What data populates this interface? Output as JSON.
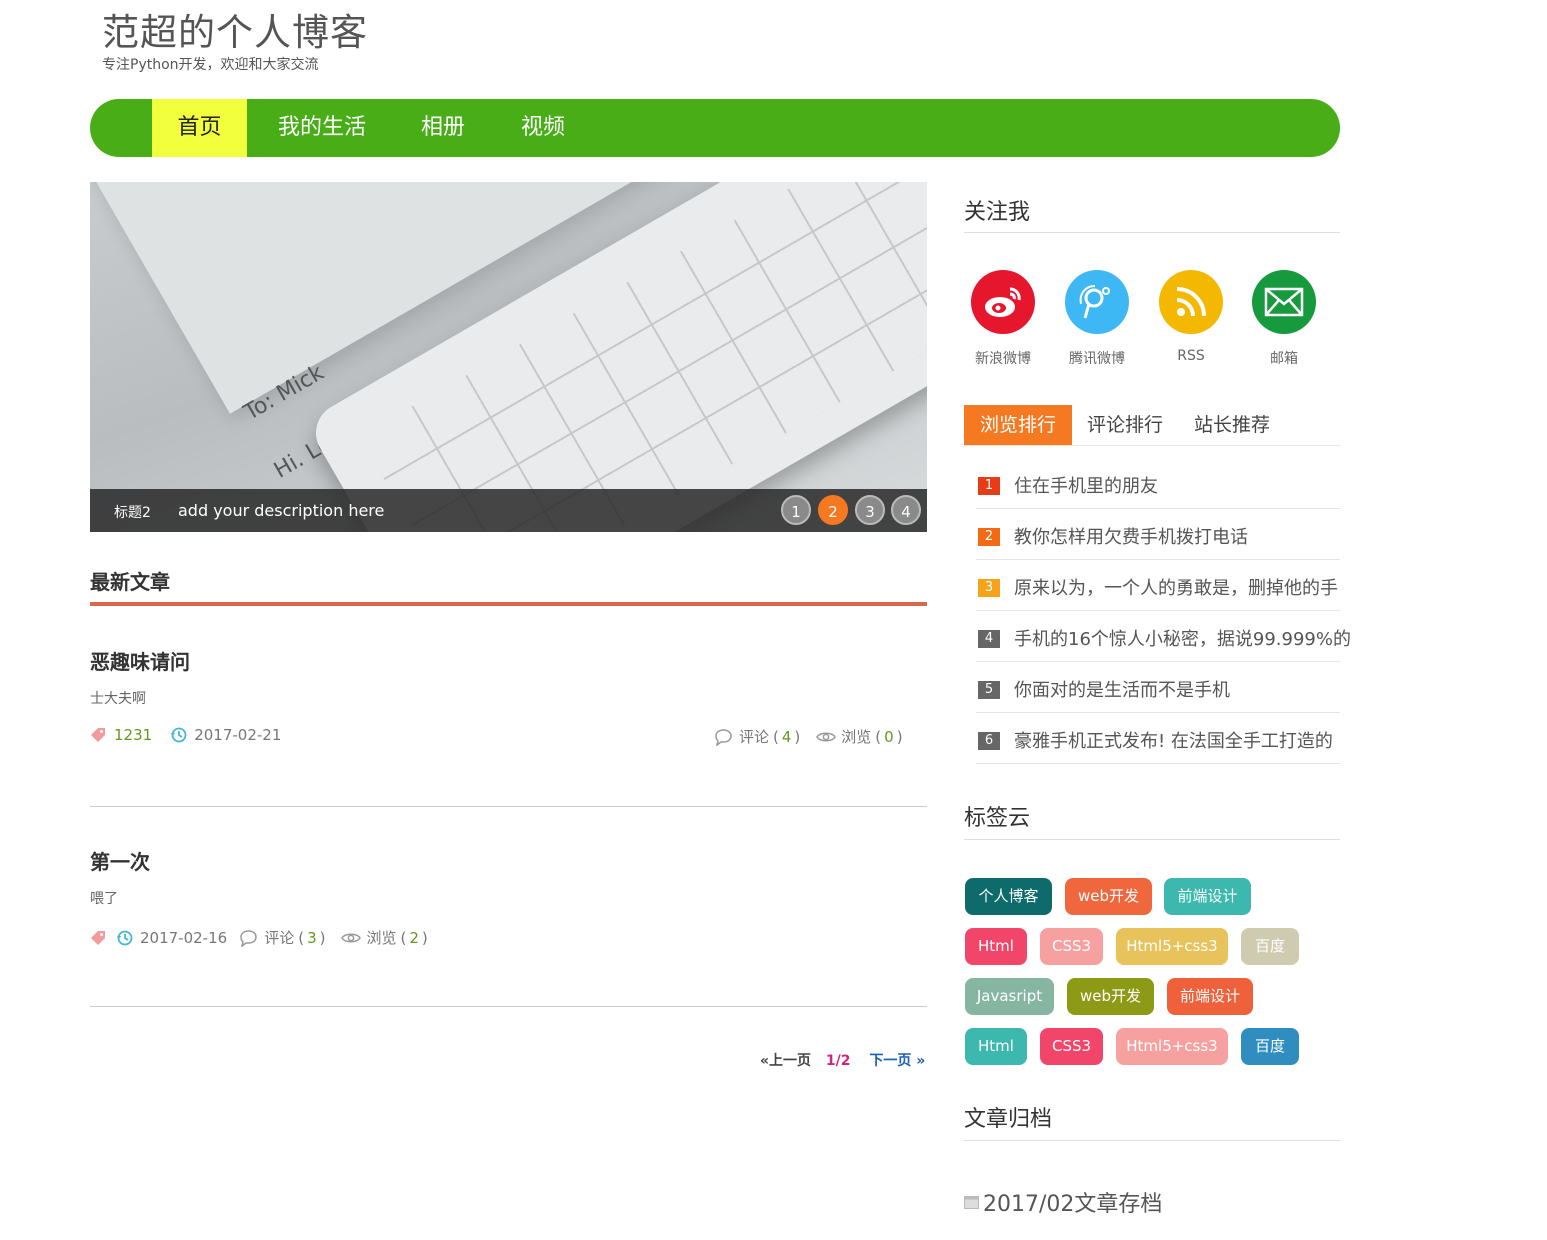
{
  "site": {
    "title": "范超的个人博客",
    "subtitle": "专注Python开发，欢迎和大家交流"
  },
  "nav": {
    "items": [
      {
        "label": "首页"
      },
      {
        "label": "我的生活"
      },
      {
        "label": "相册"
      },
      {
        "label": "视频"
      }
    ],
    "active_index": 0
  },
  "slider": {
    "image_text_line1": "To: Mick",
    "image_text_line2": "Hi. Long time no see. How",
    "caption_title": "标题2",
    "caption_desc": "add your description here",
    "dots": [
      "1",
      "2",
      "3",
      "4"
    ],
    "active_dot": 1
  },
  "latest": {
    "heading": "最新文章",
    "articles": [
      {
        "title": "恶趣味请问",
        "summary": "士大夫啊",
        "tag": "1231",
        "date": "2017-02-21",
        "comments_label": "评论",
        "comments": "4",
        "views_label": "浏览",
        "views": "0"
      },
      {
        "title": "第一次",
        "summary": "喂了",
        "tag": "",
        "date": "2017-02-16",
        "comments_label": "评论",
        "comments": "3",
        "views_label": "浏览",
        "views": "2"
      }
    ]
  },
  "pager": {
    "prev": "«上一页",
    "current": "1/2",
    "next": "下一页 »"
  },
  "sidebar": {
    "follow": {
      "heading": "关注我",
      "items": [
        {
          "label": "新浪微博",
          "icon": "weibo-icon",
          "color": "#e6162d"
        },
        {
          "label": "腾讯微博",
          "icon": "tencent-weibo-icon",
          "color": "#3eb8f4"
        },
        {
          "label": "RSS",
          "icon": "rss-icon",
          "color": "#f5b800"
        },
        {
          "label": "邮箱",
          "icon": "mail-icon",
          "color": "#169a3d"
        }
      ]
    },
    "tabs": [
      {
        "label": "浏览排行"
      },
      {
        "label": "评论排行"
      },
      {
        "label": "站长推荐"
      }
    ],
    "active_tab": 0,
    "ranking": [
      {
        "num": "1",
        "text": "住在手机里的朋友",
        "color": "#e83c16"
      },
      {
        "num": "2",
        "text": "教你怎样用欠费手机拨打电话",
        "color": "#f26b14"
      },
      {
        "num": "3",
        "text": "原来以为，一个人的勇敢是，删掉他的手",
        "color": "#f5a31a"
      },
      {
        "num": "4",
        "text": "手机的16个惊人小秘密，据说99.999%的",
        "color": "#666666"
      },
      {
        "num": "5",
        "text": "你面对的是生活而不是手机",
        "color": "#666666"
      },
      {
        "num": "6",
        "text": "豪雅手机正式发布! 在法国全手工打造的",
        "color": "#666666"
      }
    ],
    "tagcloud": {
      "heading": "标签云",
      "rows": [
        [
          {
            "label": "个人博客",
            "color": "#0e6b6b"
          },
          {
            "label": "web开发",
            "color": "#f0673e"
          },
          {
            "label": "前端设计",
            "color": "#3cb8ae"
          }
        ],
        [
          {
            "label": "Html",
            "color": "#f2456a"
          },
          {
            "label": "CSS3",
            "color": "#f7a0a0"
          },
          {
            "label": "Html5+css3",
            "color": "#e8c25a"
          },
          {
            "label": "百度",
            "color": "#cfcbb0"
          }
        ],
        [
          {
            "label": "Javasript",
            "color": "#86b5a2"
          },
          {
            "label": "web开发",
            "color": "#8c9a15"
          },
          {
            "label": "前端设计",
            "color": "#ef613b"
          }
        ],
        [
          {
            "label": "Html",
            "color": "#3cb8ae"
          },
          {
            "label": "CSS3",
            "color": "#f2456a"
          },
          {
            "label": "Html5+css3",
            "color": "#f7a0a0"
          },
          {
            "label": "百度",
            "color": "#2f8ebf"
          }
        ]
      ]
    },
    "archive": {
      "heading": "文章归档",
      "items": [
        {
          "label": "2017/02文章存档"
        }
      ]
    }
  },
  "colors": {
    "nav_bg": "#48ad17",
    "nav_active": "#f2ff3c",
    "accent_orange": "#f57921",
    "section_rule": "#d9684a"
  }
}
